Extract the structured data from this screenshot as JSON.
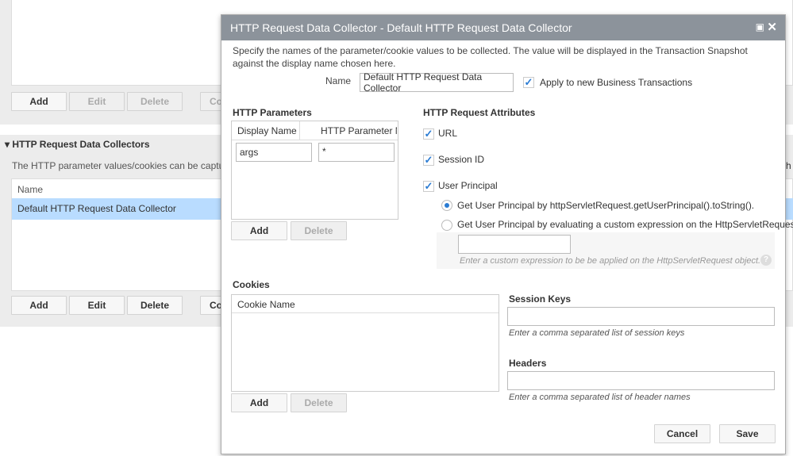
{
  "background": {
    "top_buttons": [
      "Add",
      "Edit",
      "Delete",
      "Co"
    ],
    "section_title": "HTTP Request Data Collectors",
    "section_desc": "The HTTP parameter values/cookies can be captured",
    "table_header": "Name",
    "rows": [
      "Default HTTP Request Data Collector"
    ],
    "bottom_buttons": [
      "Add",
      "Edit",
      "Delete",
      "Co"
    ],
    "right_fragment": "h"
  },
  "dialog": {
    "title": "HTTP Request Data Collector - Default HTTP Request Data Collector",
    "description": "Specify the names of the parameter/cookie values to be collected. The value will be displayed in the Transaction Snapshot against the display name chosen here.",
    "name_label": "Name",
    "name_value": "Default HTTP Request Data Collector",
    "apply_label": "Apply to new Business Transactions",
    "apply_checked": true,
    "params": {
      "title": "HTTP Parameters",
      "col1": "Display Name",
      "col2": "HTTP Parameter Name",
      "rows": [
        {
          "display": "args",
          "param": "*"
        }
      ],
      "add": "Add",
      "delete": "Delete"
    },
    "attrs": {
      "title": "HTTP Request Attributes",
      "url": "URL",
      "session": "Session ID",
      "principal": "User Principal",
      "radio1": "Get User Principal by httpServletRequest.getUserPrincipal().toString().",
      "radio2": "Get User Principal by evaluating a custom expression on the HttpServletRequest:",
      "expr_value": "",
      "expr_hint": "Enter a custom expression to be be applied on the HttpServletRequest object."
    },
    "cookies": {
      "title": "Cookies",
      "col": "Cookie Name",
      "add": "Add",
      "delete": "Delete"
    },
    "session_keys": {
      "title": "Session Keys",
      "value": "",
      "hint": "Enter a comma separated list of session keys"
    },
    "headers": {
      "title": "Headers",
      "value": "",
      "hint": "Enter a comma separated list of header names"
    },
    "cancel": "Cancel",
    "save": "Save"
  },
  "colors": {
    "title_bar": "#8c939b",
    "selected_row": "#b9dcff",
    "check": "#2a7bd3"
  }
}
